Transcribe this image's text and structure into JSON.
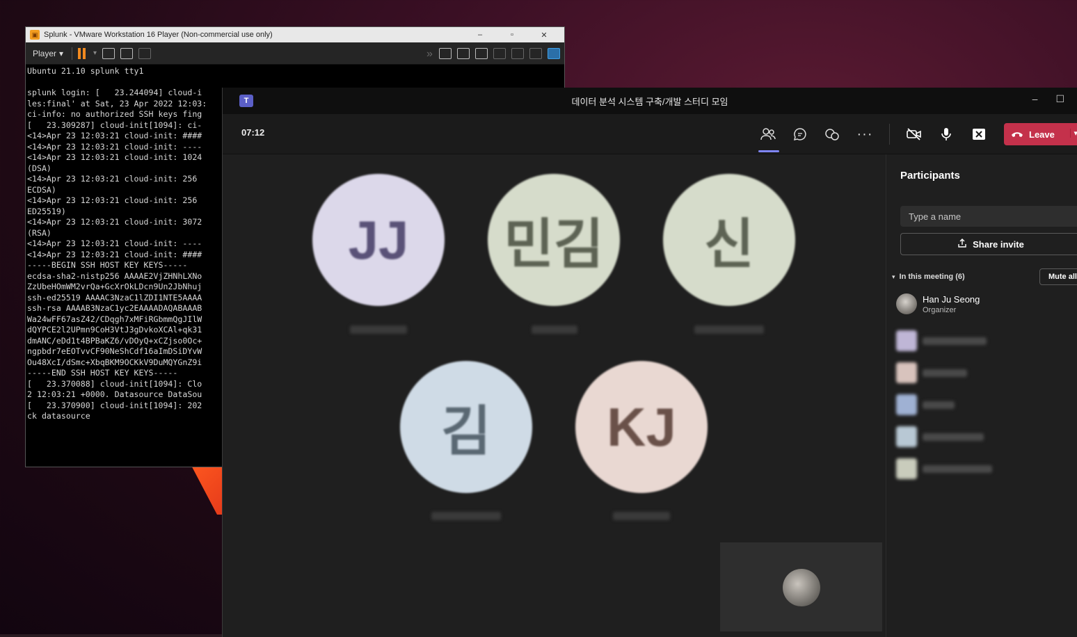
{
  "vmware": {
    "title": "Splunk - VMware Workstation 16 Player (Non-commercial use only)",
    "player_menu": "Player",
    "minimize": "–",
    "maximize": "▫",
    "close": "✕",
    "terminal_lines": [
      "Ubuntu 21.10 splunk tty1",
      "",
      "splunk login: [   23.244094] cloud-i",
      "les:final' at Sat, 23 Apr 2022 12:03:",
      "ci-info: no authorized SSH keys fing",
      "[   23.309287] cloud-init[1094]: ci-",
      "<14>Apr 23 12:03:21 cloud-init: ####",
      "<14>Apr 23 12:03:21 cloud-init: ----",
      "<14>Apr 23 12:03:21 cloud-init: 1024",
      "(DSA)",
      "<14>Apr 23 12:03:21 cloud-init: 256 ",
      "ECDSA)",
      "<14>Apr 23 12:03:21 cloud-init: 256 ",
      "ED25519)",
      "<14>Apr 23 12:03:21 cloud-init: 3072",
      "(RSA)",
      "<14>Apr 23 12:03:21 cloud-init: ----",
      "<14>Apr 23 12:03:21 cloud-init: ####",
      "-----BEGIN SSH HOST KEY KEYS-----",
      "ecdsa-sha2-nistp256 AAAAE2VjZHNhLXNo",
      "ZzUbeHOmWM2vrQa+GcXrOkLDcn9Un2JbNhuj",
      "ssh-ed25519 AAAAC3NzaC1lZDI1NTE5AAAA",
      "ssh-rsa AAAAB3NzaC1yc2EAAAADAQABAAAB",
      "Wa24wFF67asZ42/CDqgh7xMFiRGbmmQgJIlW",
      "dQYPCE2l2UPmn9CoH3VtJ3gDvkoXCAl+qk31",
      "dmANC/eDd1t4BPBaKZ6/vDOyQ+xCZjso0Oc+",
      "ngpbdr7eEOTvvCF90NeShCdf16aImDSiDYvW",
      "Ou48XcI/dSmc+XbqBKM9OCKkV9DuMQYGnZ9i",
      "-----END SSH HOST KEY KEYS-----",
      "[   23.370088] cloud-init[1094]: Clo",
      "2 12:03:21 +0000. Datasource DataSou",
      "[   23.370900] cloud-init[1094]: 202",
      "ck datasource"
    ]
  },
  "teams": {
    "title": "데이터 분석 시스템 구축/개발 스터디 모임",
    "timer": "07:12",
    "leave_label": "Leave",
    "minimize": "–",
    "maximize": "☐",
    "icons": {
      "people": "people-icon",
      "chat": "chat-icon",
      "reactions": "reactions-icon",
      "more": "more-icon",
      "camera": "camera-off-icon",
      "mic": "mic-icon",
      "share": "share-screen-icon"
    },
    "stage": {
      "avatars": [
        {
          "initials": "JJ",
          "bg": "#dcd8ea",
          "fg": "#5a5278"
        },
        {
          "initials": "민김",
          "bg": "#d6dccb",
          "fg": "#5d6354"
        },
        {
          "initials": "신",
          "bg": "#d6dccb",
          "fg": "#5d6354"
        },
        {
          "initials": "김",
          "bg": "#cfdbe6",
          "fg": "#5a6873"
        },
        {
          "initials": "KJ",
          "bg": "#e9d8d2",
          "fg": "#6a5149"
        }
      ]
    },
    "panel": {
      "title": "Participants",
      "search_placeholder": "Type a name",
      "share_invite": "Share invite",
      "section_label": "In this meeting (6)",
      "mute_all": "Mute all",
      "organizer": {
        "name": "Han Ju Seong",
        "role": "Organizer"
      }
    },
    "colors": {
      "leave": "#c4314b",
      "accent": "#7f85f5",
      "teams_brand": "#5b5fc7"
    }
  }
}
